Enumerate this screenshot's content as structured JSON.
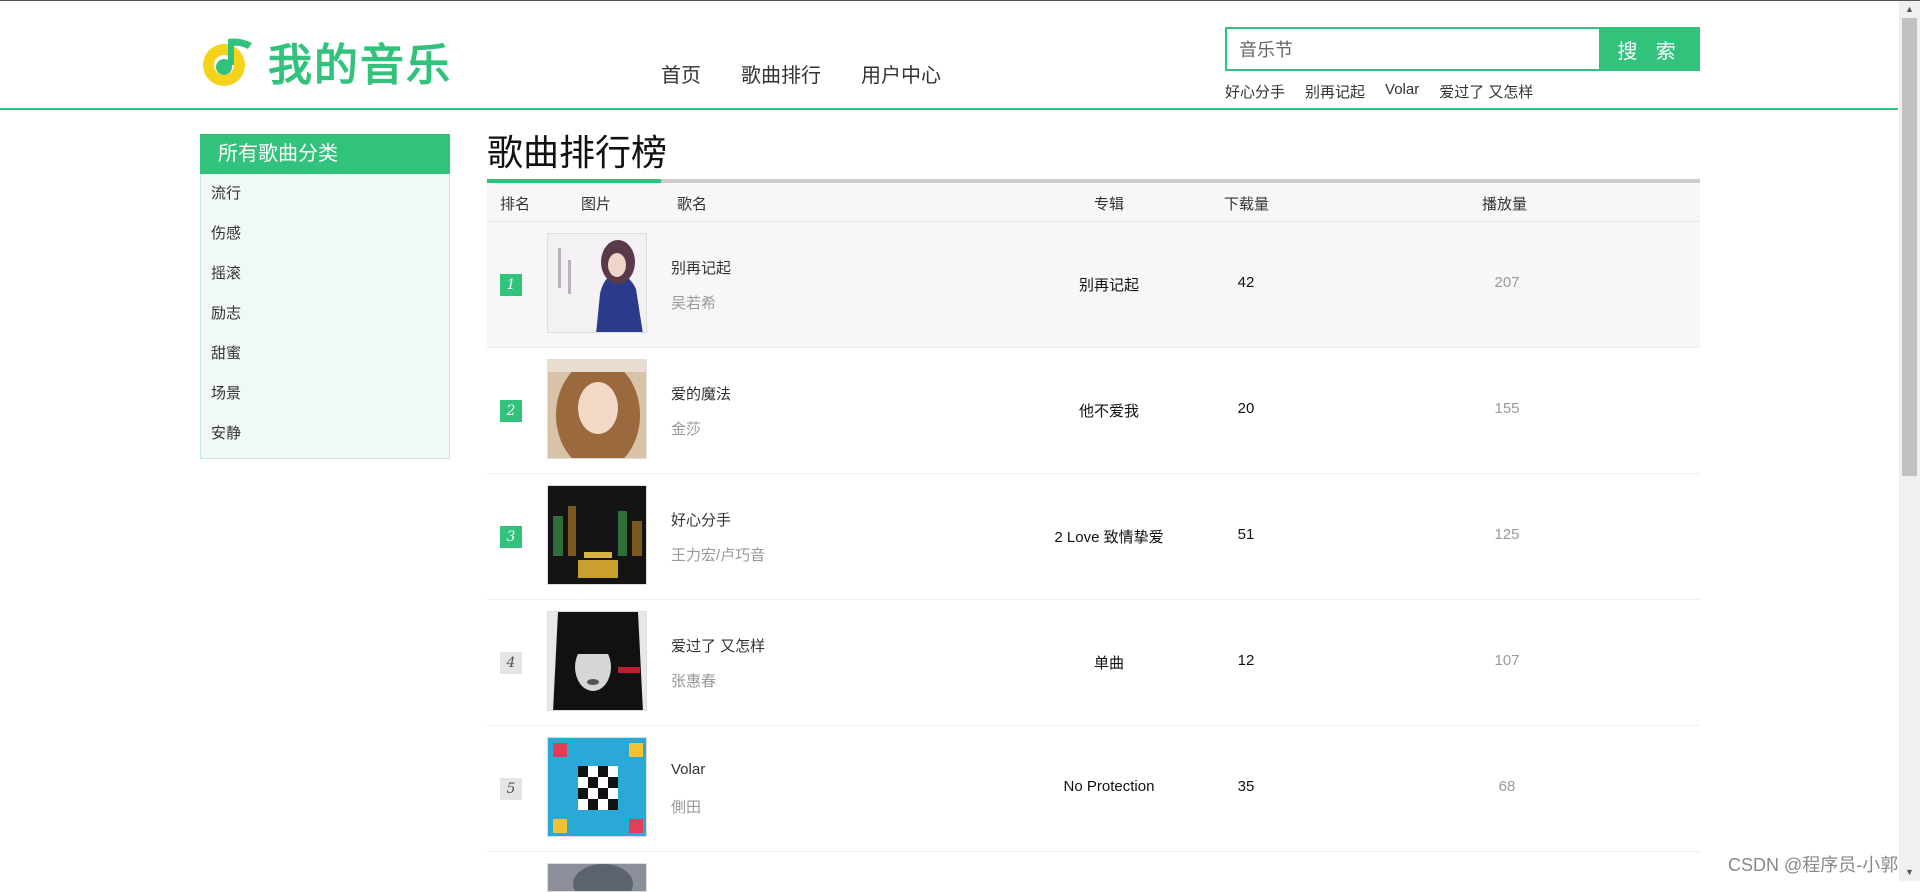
{
  "header": {
    "logo_text": "我的音乐",
    "nav": [
      "首页",
      "歌曲排行",
      "用户中心"
    ],
    "search_value": "音乐节",
    "search_button": "搜 索",
    "hot_keywords": [
      "好心分手",
      "别再记起",
      "Volar",
      "爱过了 又怎样"
    ]
  },
  "sidebar": {
    "title": "所有歌曲分类",
    "items": [
      "流行",
      "伤感",
      "摇滚",
      "励志",
      "甜蜜",
      "场景",
      "安静"
    ]
  },
  "main": {
    "title": "歌曲排行榜",
    "columns": [
      "排名",
      "图片",
      "歌名",
      "专辑",
      "下载量",
      "播放量"
    ],
    "rows": [
      {
        "rank": "1",
        "song": "别再记起",
        "singer": "吴若希",
        "album": "别再记起",
        "downloads": "42",
        "plays": "207"
      },
      {
        "rank": "2",
        "song": "爱的魔法",
        "singer": "金莎",
        "album": "他不爱我",
        "downloads": "20",
        "plays": "155"
      },
      {
        "rank": "3",
        "song": "好心分手",
        "singer": "王力宏/卢巧音",
        "album": "2 Love 致情挚爱",
        "downloads": "51",
        "plays": "125"
      },
      {
        "rank": "4",
        "song": "爱过了 又怎样",
        "singer": "张惠春",
        "album": "单曲",
        "downloads": "12",
        "plays": "107"
      },
      {
        "rank": "5",
        "song": "Volar",
        "singer": "側田",
        "album": "No Protection",
        "downloads": "35",
        "plays": "68"
      }
    ]
  },
  "watermark": "CSDN @程序员-小郭",
  "colors": {
    "accent": "#31c27c",
    "logo_yellow": "#f5d31b"
  }
}
